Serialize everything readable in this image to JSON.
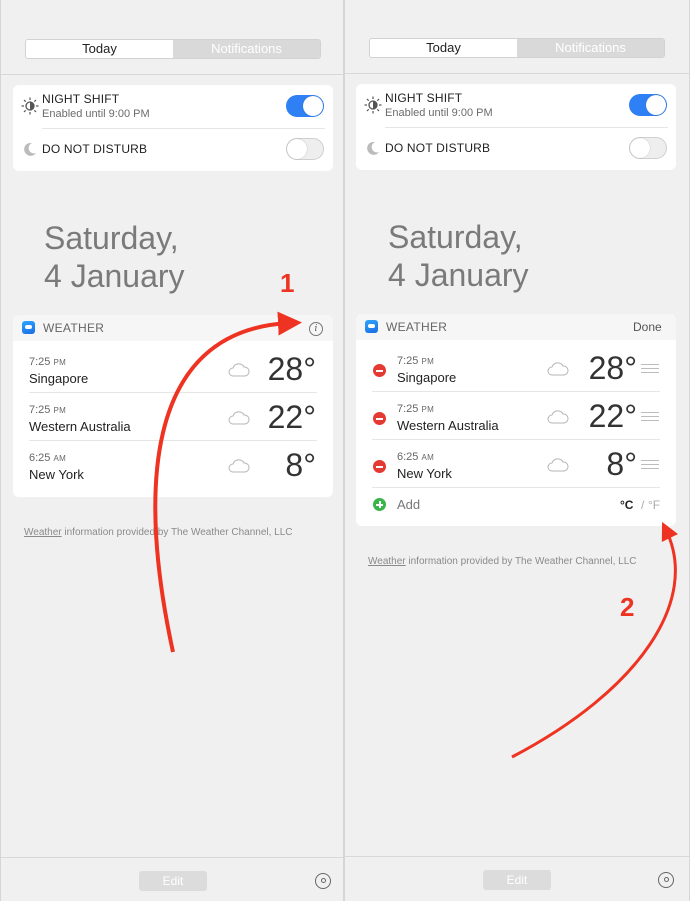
{
  "tabs": {
    "today": "Today",
    "notifications": "Notifications"
  },
  "night_shift": {
    "title": "NIGHT SHIFT",
    "subtitle": "Enabled until 9:00 PM",
    "state": "on"
  },
  "dnd": {
    "title": "DO NOT DISTURB",
    "state": "off"
  },
  "date": {
    "line1": "Saturday,",
    "line2": "4 January"
  },
  "weather": {
    "title": "WEATHER",
    "done_label": "Done",
    "add_label": "Add",
    "unit_c": "°C",
    "unit_sep": "/",
    "unit_f": "°F",
    "rows": [
      {
        "time": "7:25",
        "ampm": "PM",
        "city": "Singapore",
        "temp": "28°"
      },
      {
        "time": "7:25",
        "ampm": "PM",
        "city": "Western Australia",
        "temp": "22°"
      },
      {
        "time": "6:25",
        "ampm": "AM",
        "city": "New York",
        "temp": "8°"
      }
    ]
  },
  "credit": {
    "link": "Weather",
    "rest": " information provided by The Weather Channel, LLC"
  },
  "footer": {
    "edit_label": "Edit"
  },
  "annotations": {
    "one": "1",
    "two": "2"
  },
  "colors": {
    "accent": "#2f7ff5",
    "arrow": "#ee3322",
    "remove": "#e53a32",
    "add": "#3ab54a"
  }
}
